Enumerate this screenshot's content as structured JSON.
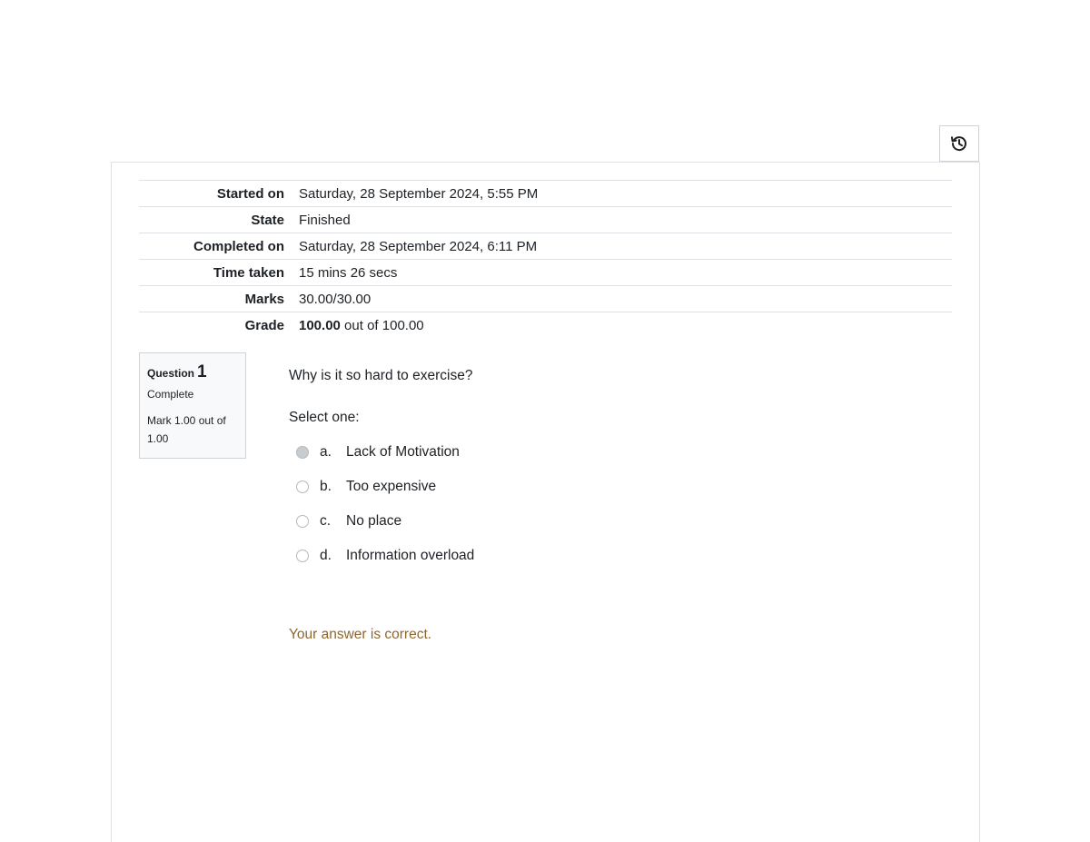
{
  "summary": {
    "rows": [
      {
        "label": "Started on",
        "value": "Saturday, 28 September 2024, 5:55 PM"
      },
      {
        "label": "State",
        "value": "Finished"
      },
      {
        "label": "Completed on",
        "value": "Saturday, 28 September 2024, 6:11 PM"
      },
      {
        "label": "Time taken",
        "value": "15 mins 26 secs"
      },
      {
        "label": "Marks",
        "value": "30.00/30.00"
      }
    ],
    "grade": {
      "label": "Grade",
      "score": "100.00",
      "rest": " out of 100.00"
    }
  },
  "question": {
    "label": "Question",
    "number": "1",
    "state": "Complete",
    "mark": "Mark 1.00 out of 1.00",
    "text": "Why is it so hard to exercise?",
    "prompt": "Select one:",
    "answers": [
      {
        "letter": "a.",
        "text": "Lack of Motivation",
        "selected": true
      },
      {
        "letter": "b.",
        "text": "Too expensive",
        "selected": false
      },
      {
        "letter": "c.",
        "text": "No place",
        "selected": false
      },
      {
        "letter": "d.",
        "text": "Information overload",
        "selected": false
      }
    ],
    "feedback": "Your answer is correct."
  },
  "icons": {
    "history": "history-icon"
  },
  "colors": {
    "feedback": "#8e662e",
    "border": "#dee2e6"
  }
}
